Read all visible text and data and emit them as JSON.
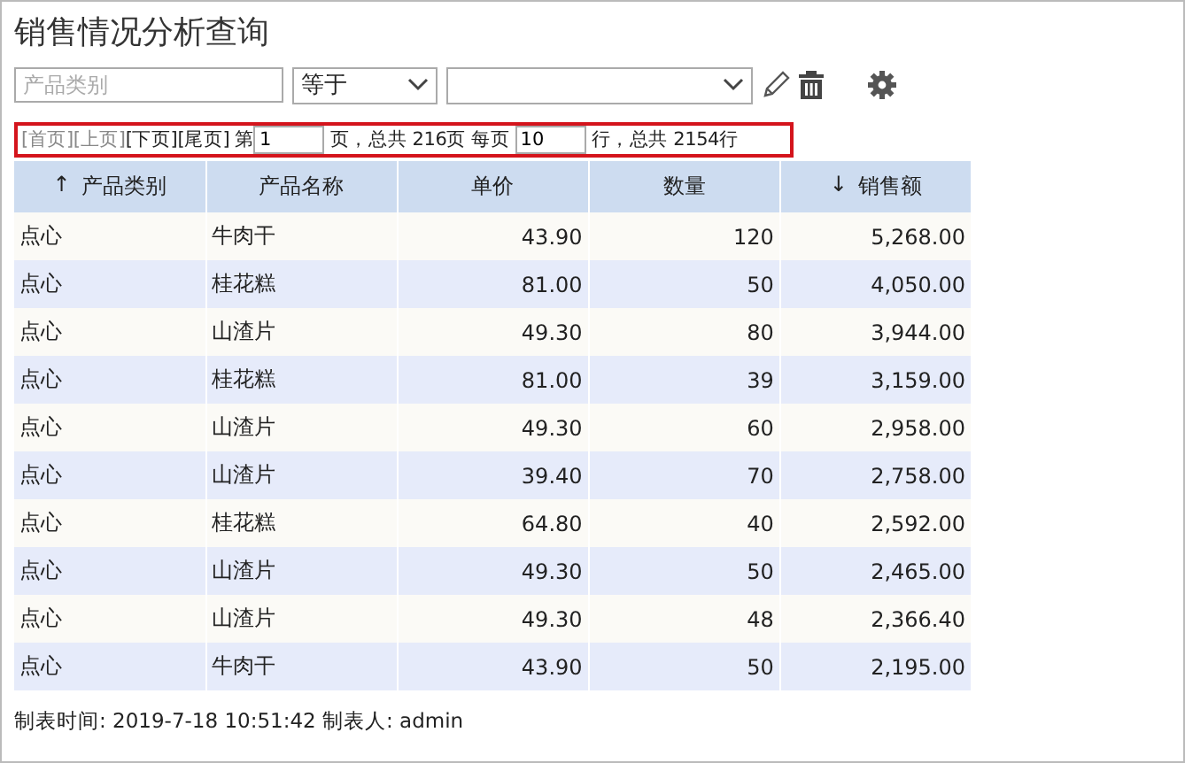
{
  "title": "销售情况分析查询",
  "filter": {
    "field": {
      "placeholder": "产品类别"
    },
    "operator": {
      "value": "等于"
    }
  },
  "pager": {
    "links": [
      {
        "label": "[首页]",
        "disabled": true
      },
      {
        "label": "[上页]",
        "disabled": true
      },
      {
        "label": "[下页]",
        "disabled": false
      },
      {
        "label": "[尾页]",
        "disabled": false
      }
    ],
    "page_prefix": "第",
    "page_value": "1",
    "page_suffix": "页，总共 216页 每页",
    "size_value": "10",
    "size_suffix": "行，总共 2154行"
  },
  "table": {
    "columns": [
      {
        "label": "产品类别",
        "sort_icon": "↑",
        "kind": "text"
      },
      {
        "label": "产品名称",
        "kind": "text"
      },
      {
        "label": "单价",
        "kind": "number"
      },
      {
        "label": "数量",
        "kind": "number"
      },
      {
        "label": "销售额",
        "sort_icon": "↓",
        "kind": "number"
      }
    ],
    "rows": [
      [
        "点心",
        "牛肉干",
        "43.90",
        "120",
        "5,268.00"
      ],
      [
        "点心",
        "桂花糕",
        "81.00",
        "50",
        "4,050.00"
      ],
      [
        "点心",
        "山渣片",
        "49.30",
        "80",
        "3,944.00"
      ],
      [
        "点心",
        "桂花糕",
        "81.00",
        "39",
        "3,159.00"
      ],
      [
        "点心",
        "山渣片",
        "49.30",
        "60",
        "2,958.00"
      ],
      [
        "点心",
        "山渣片",
        "39.40",
        "70",
        "2,758.00"
      ],
      [
        "点心",
        "桂花糕",
        "64.80",
        "40",
        "2,592.00"
      ],
      [
        "点心",
        "山渣片",
        "49.30",
        "50",
        "2,465.00"
      ],
      [
        "点心",
        "山渣片",
        "49.30",
        "48",
        "2,366.40"
      ],
      [
        "点心",
        "牛肉干",
        "43.90",
        "50",
        "2,195.00"
      ]
    ]
  },
  "footer": "制表时间: 2019-7-18 10:51:42 制表人: admin"
}
